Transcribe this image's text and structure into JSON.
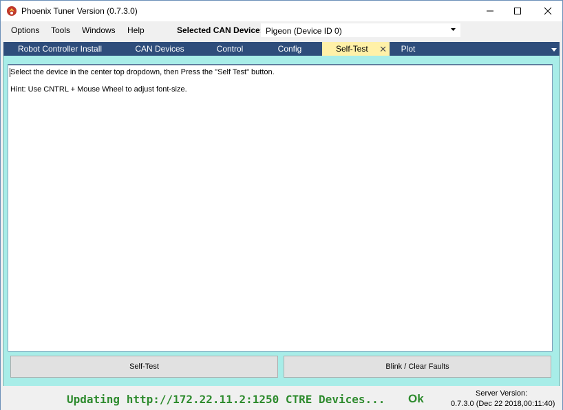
{
  "window": {
    "title": "Phoenix Tuner Version (0.7.3.0)"
  },
  "menubar": {
    "items": [
      "Options",
      "Tools",
      "Windows",
      "Help"
    ],
    "can_device_label": "Selected CAN Device:",
    "can_device_value": "Pigeon (Device ID 0)"
  },
  "tabs": [
    {
      "label": "Robot Controller Install",
      "active": false
    },
    {
      "label": "CAN Devices",
      "active": false
    },
    {
      "label": "Control",
      "active": false
    },
    {
      "label": "Config",
      "active": false
    },
    {
      "label": "Self-Test",
      "active": true
    },
    {
      "label": "Plot",
      "active": false
    }
  ],
  "selftest": {
    "lines": [
      "Select the device in the center top dropdown, then Press the \"Self Test\" button.",
      "Hint: Use CNTRL + Mouse Wheel to adjust font-size."
    ],
    "self_test_button": "Self-Test",
    "blink_button": "Blink / Clear Faults"
  },
  "status": {
    "updating": "Updating http://172.22.11.2:1250 CTRE Devices...",
    "ok": "Ok",
    "server_label": "Server Version:",
    "server_value": "0.7.3.0 (Dec 22 2018,00:11:40)"
  },
  "colors": {
    "tab_strip": "#2e4d7b",
    "tab_active": "#fff1a8",
    "content_bg": "#a8ede8",
    "status_green": "#2e8b2e"
  }
}
